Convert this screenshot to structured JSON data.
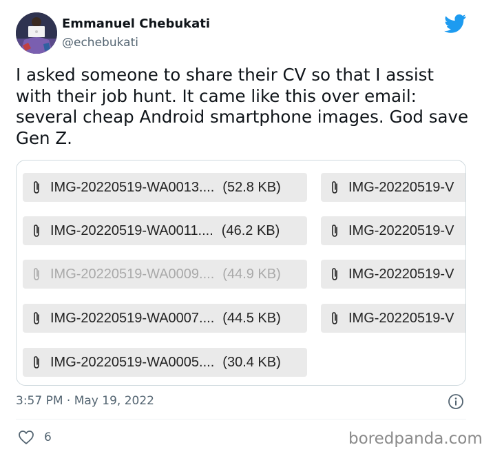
{
  "author": {
    "name": "Emmanuel Chebukati",
    "handle": "@echebukati"
  },
  "tweet": {
    "text": "I asked someone to share their CV so that I assist with their job hunt. It came like this over email: several cheap Android smartphone images. God save Gen Z."
  },
  "attachments": {
    "left_column": [
      {
        "name": "IMG-20220519-WA0013....",
        "size": "(52.8 KB)",
        "state": "normal"
      },
      {
        "name": "IMG-20220519-WA0011....",
        "size": "(46.2 KB)",
        "state": "normal"
      },
      {
        "name": "IMG-20220519-WA0009....",
        "size": "(44.9 KB)",
        "state": "dimmed"
      },
      {
        "name": "IMG-20220519-WA0007....",
        "size": "(44.5 KB)",
        "state": "normal"
      },
      {
        "name": "IMG-20220519-WA0005....",
        "size": "(30.4 KB)",
        "state": "normal"
      }
    ],
    "right_column": [
      {
        "name": "IMG-20220519-V"
      },
      {
        "name": "IMG-20220519-V"
      },
      {
        "name": "IMG-20220519-V"
      },
      {
        "name": "IMG-20220519-V"
      }
    ]
  },
  "meta": {
    "timestamp": "3:57 PM · May 19, 2022",
    "likes": "6"
  },
  "watermark": "boredpanda.com",
  "icons": [
    "twitter-bird-icon",
    "paperclip-icon",
    "info-icon",
    "heart-icon"
  ],
  "colors": {
    "twitter_blue": "#1d9bf0",
    "text_primary": "#0f1419",
    "text_secondary": "#536471",
    "chip_background": "#eaeaea",
    "dimmed_text": "#a9a9a9"
  }
}
